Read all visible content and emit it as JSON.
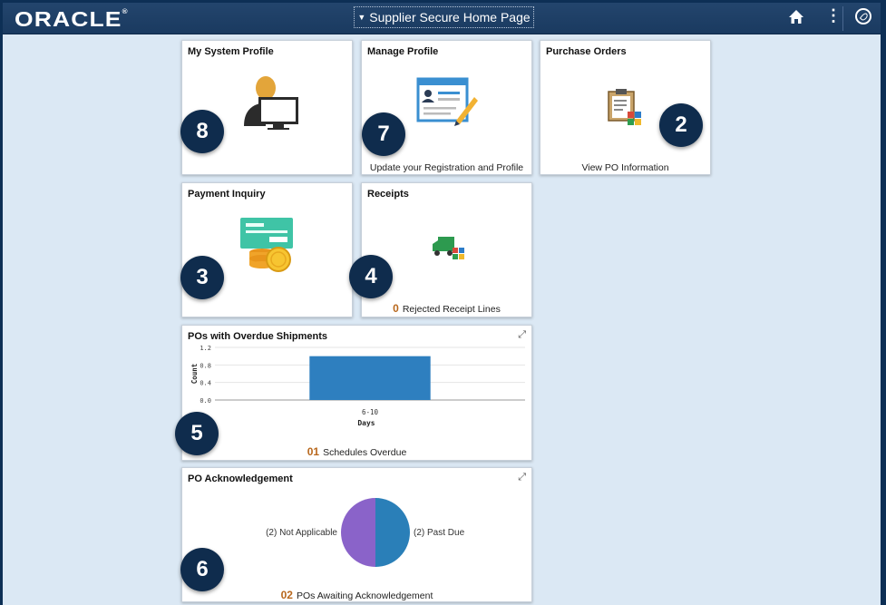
{
  "header": {
    "logo": "ORACLE",
    "page_title": "Supplier Secure Home Page"
  },
  "tiles": {
    "system_profile": {
      "title": "My System Profile",
      "badge": "8"
    },
    "manage_profile": {
      "title": "Manage Profile",
      "footer": "Update your Registration and Profile",
      "badge": "7"
    },
    "purchase_orders": {
      "title": "Purchase Orders",
      "footer": "View PO Information",
      "badge": "2"
    },
    "payment_inquiry": {
      "title": "Payment Inquiry",
      "badge": "3"
    },
    "receipts": {
      "title": "Receipts",
      "count": "0",
      "footer": "Rejected Receipt Lines",
      "badge": "4"
    },
    "overdue": {
      "title": "POs with Overdue Shipments",
      "count": "01",
      "footer": "Schedules Overdue",
      "badge": "5"
    },
    "acknowledgement": {
      "title": "PO Acknowledgement",
      "count": "02",
      "footer": "POs Awaiting Acknowledgement",
      "badge": "6"
    }
  },
  "chart_data": [
    {
      "type": "bar",
      "categories": [
        "6-10"
      ],
      "values": [
        1
      ],
      "xlabel": "Days",
      "ylabel": "Count",
      "yticks": [
        "1.2",
        "0.8",
        "0.4",
        "0.0"
      ],
      "ylim": [
        0,
        1.2
      ],
      "color": "#2e7fbf"
    },
    {
      "type": "pie",
      "slices": [
        {
          "label": "(2) Not Applicable",
          "value": 2,
          "color": "#8a63c9"
        },
        {
          "label": "(2) Past Due",
          "value": 2,
          "color": "#2a7fb8"
        }
      ]
    }
  ]
}
